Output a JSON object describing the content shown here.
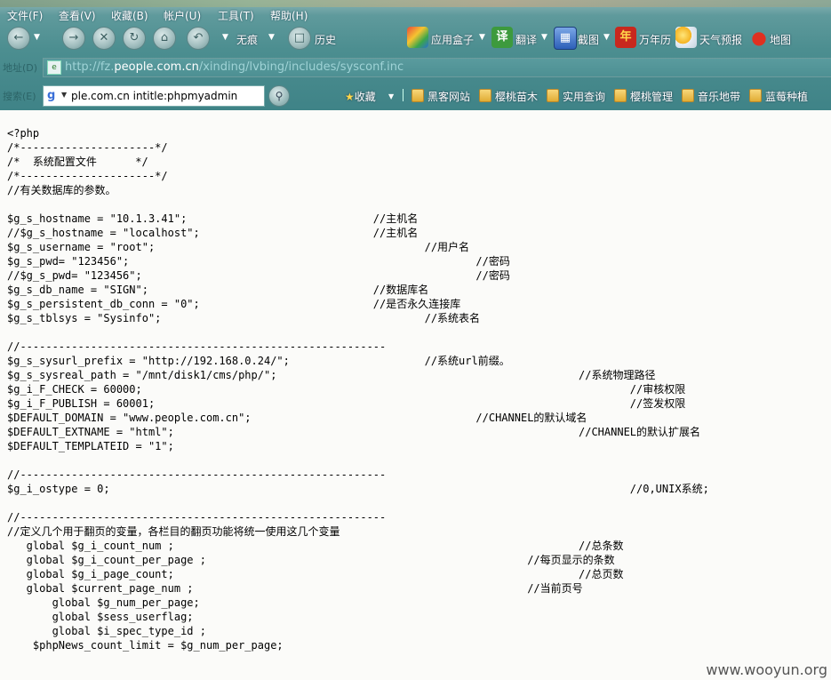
{
  "menu": [
    "文件(F)",
    "查看(V)",
    "收藏(B)",
    "帐户(U)",
    "工具(T)",
    "帮助(H)"
  ],
  "nav": {
    "incognito_label": "无痕",
    "history_label": "历史",
    "tools": [
      {
        "label": "应用盒子",
        "icon": "app-box-icon"
      },
      {
        "label": "翻译",
        "icon": "translate-icon",
        "glyph": "译"
      },
      {
        "label": "截图",
        "icon": "screenshot-icon"
      },
      {
        "label": "万年历",
        "icon": "calendar-icon",
        "glyph": "年"
      },
      {
        "label": "天气预报",
        "icon": "weather-icon"
      },
      {
        "label": "地图",
        "icon": "map-pin-icon"
      }
    ]
  },
  "address": {
    "label": "地址(D)",
    "url_prefix": "http://fz.",
    "url_domain": "people.com.cn",
    "url_suffix": "/xinding/lvbing/includes/sysconf.inc"
  },
  "search": {
    "label": "搜索(E)",
    "value": "ple.com.cn intitle:phpmyadmin"
  },
  "favorites": {
    "label": "收藏",
    "items": [
      "黑客网站",
      "樱桃苗木",
      "实用查询",
      "樱桃管理",
      "音乐地带",
      "蓝莓种植"
    ]
  },
  "code_lines": [
    "<?php",
    "/*---------------------*/",
    "/*  系统配置文件      */",
    "/*---------------------*/",
    "//有关数据库的参数。",
    "",
    "$g_s_hostname = \"10.1.3.41\";                             //主机名",
    "//$g_s_hostname = \"localhost\";                           //主机名",
    "$g_s_username = \"root\";                                          //用户名",
    "$g_s_pwd= \"123456\";                                                      //密码",
    "//$g_s_pwd= \"123456\";                                                    //密码",
    "$g_s_db_name = \"SIGN\";                                   //数据库名",
    "$g_s_persistent_db_conn = \"0\";                           //是否永久连接库",
    "$g_s_tblsys = \"Sysinfo\";                                         //系统表名",
    "",
    "//---------------------------------------------------------",
    "$g_s_sysurl_prefix = \"http://192.168.0.24/\";                     //系统url前缀。",
    "$g_s_sysreal_path = \"/mnt/disk1/cms/php/\";                                               //系统物理路径",
    "$g_i_F_CHECK = 60000;                                                                            //审核权限",
    "$g_i_F_PUBLISH = 60001;                                                                          //签发权限",
    "$DEFAULT_DOMAIN = \"www.people.com.cn\";                                   //CHANNEL的默认域名",
    "$DEFAULT_EXTNAME = \"html\";                                                               //CHANNEL的默认扩展名",
    "$DEFAULT_TEMPLATEID = \"1\";",
    "",
    "//---------------------------------------------------------",
    "$g_i_ostype = 0;                                                                                 //0,UNIX系统;",
    "",
    "//---------------------------------------------------------",
    "//定义几个用于翻页的变量，各栏目的翻页功能将统一使用这几个变量",
    "   global $g_i_count_num ;                                                               //总条数",
    "   global $g_i_count_per_page ;                                                  //每页显示的条数",
    "   global $g_i_page_count;                                                               //总页数",
    "   global $current_page_num ;                                                    //当前页号",
    "       global $g_num_per_page;",
    "       global $sess_userflag;",
    "       global $i_spec_type_id ;",
    "    $phpNews_count_limit = $g_num_per_page;"
  ],
  "watermark": "www.wooyun.org"
}
